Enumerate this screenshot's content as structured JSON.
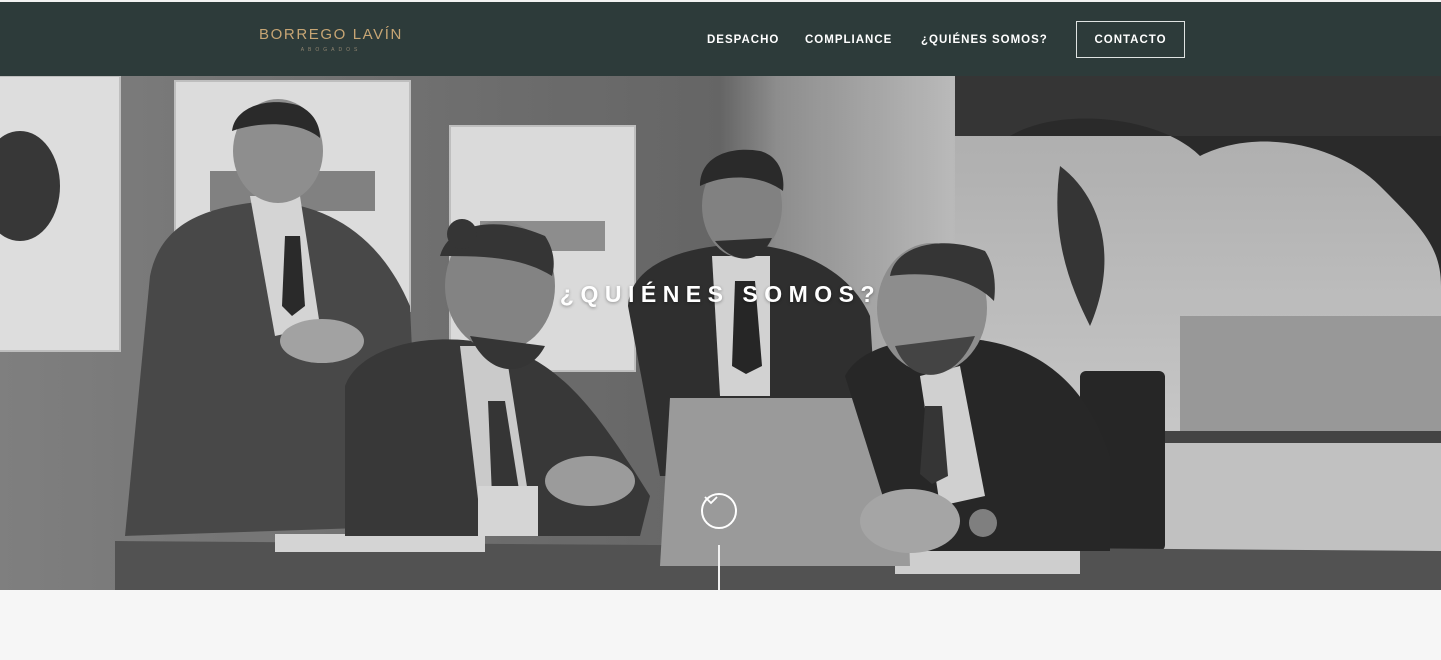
{
  "brand": {
    "name": "BORREGO LAVÍN",
    "tagline": "ABOGADOS",
    "color": "#c7a574"
  },
  "nav": {
    "items": [
      {
        "label": "DESPACHO"
      },
      {
        "label": "COMPLIANCE"
      },
      {
        "label": "¿QUIÉNES SOMOS?"
      }
    ],
    "contact_label": "CONTACTO"
  },
  "hero": {
    "title": "¿QUIÉNES SOMOS?",
    "scroll_icon": "chevron-down-icon"
  },
  "colors": {
    "header_bg": "#2d3b3a",
    "page_bg": "#f6f6f6"
  }
}
